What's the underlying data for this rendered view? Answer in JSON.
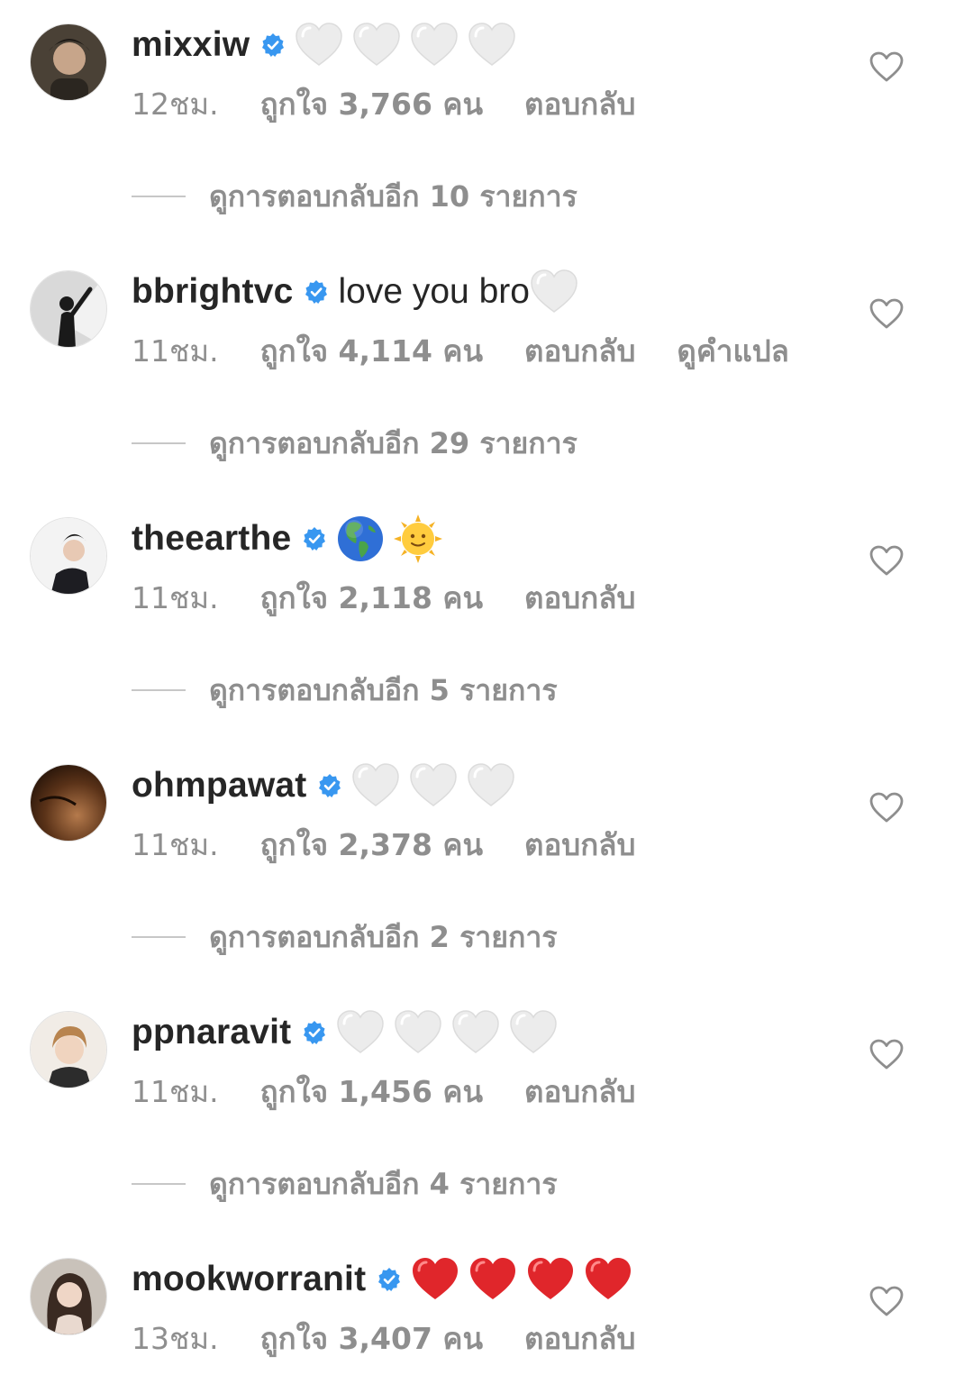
{
  "comments": [
    {
      "username": "mixxiw",
      "verified": true,
      "text": "",
      "emojis": [
        "white-heart",
        "white-heart",
        "white-heart",
        "white-heart"
      ],
      "time": "12ชม.",
      "likes": "ถูกใจ 3,766 คน",
      "reply": "ตอบกลับ",
      "translate": "",
      "view_replies": "ดูการตอบกลับอีก 10 รายการ"
    },
    {
      "username": "bbrightvc",
      "verified": true,
      "text": "love you bro",
      "emojis": [
        "white-heart"
      ],
      "time": "11ชม.",
      "likes": "ถูกใจ 4,114 คน",
      "reply": "ตอบกลับ",
      "translate": "ดูคำแปล",
      "view_replies": "ดูการตอบกลับอีก 29 รายการ"
    },
    {
      "username": "theearthe",
      "verified": true,
      "text": "",
      "emojis": [
        "globe-americas",
        "sun-with-face"
      ],
      "time": "11ชม.",
      "likes": "ถูกใจ 2,118 คน",
      "reply": "ตอบกลับ",
      "translate": "",
      "view_replies": "ดูการตอบกลับอีก 5 รายการ"
    },
    {
      "username": "ohmpawat",
      "verified": true,
      "text": "",
      "emojis": [
        "white-heart",
        "white-heart",
        "white-heart"
      ],
      "time": "11ชม.",
      "likes": "ถูกใจ 2,378 คน",
      "reply": "ตอบกลับ",
      "translate": "",
      "view_replies": "ดูการตอบกลับอีก 2 รายการ"
    },
    {
      "username": "ppnaravit",
      "verified": true,
      "text": "",
      "emojis": [
        "white-heart",
        "white-heart",
        "white-heart",
        "white-heart"
      ],
      "time": "11ชม.",
      "likes": "ถูกใจ 1,456 คน",
      "reply": "ตอบกลับ",
      "translate": "",
      "view_replies": "ดูการตอบกลับอีก 4 รายการ"
    },
    {
      "username": "mookworranit",
      "verified": true,
      "text": "",
      "emojis": [
        "red-heart",
        "red-heart",
        "red-heart",
        "red-heart"
      ],
      "time": "13ชม.",
      "likes": "ถูกใจ 3,407 คน",
      "reply": "ตอบกลับ",
      "translate": "",
      "view_replies": ""
    }
  ],
  "colors": {
    "username": "#262626",
    "meta": "#8e8e8e",
    "verified_badge": "#3897f0",
    "white_heart": "#eeeeee",
    "red_heart": "#e0262b"
  }
}
